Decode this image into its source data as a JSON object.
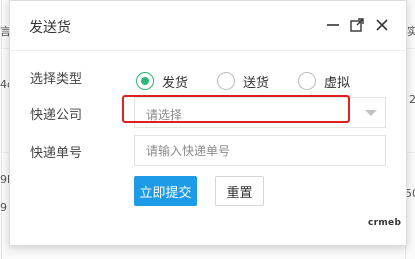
{
  "background": {
    "fragments": [
      "言",
      "4c",
      "9h",
      "9",
      "实",
      "2",
      "50"
    ]
  },
  "dialog": {
    "title": "发送货",
    "icons": [
      "minimize-icon",
      "maximize-icon",
      "close-icon"
    ]
  },
  "form": {
    "type_label": "选择类型",
    "type_options": [
      "发货",
      "送货",
      "虚拟"
    ],
    "type_selected": "发货",
    "company_label": "快递公司",
    "company_placeholder": "请选择",
    "number_label": "快递单号",
    "number_placeholder": "请输入快递单号",
    "number_value": ""
  },
  "buttons": {
    "submit_label": "立即提交",
    "reset_label": "重置"
  },
  "watermark": {
    "text": "crmeb"
  },
  "colors": {
    "accent_green": "#2fb67a",
    "primary_blue": "#1e9be6",
    "highlight_red": "#e02020"
  }
}
